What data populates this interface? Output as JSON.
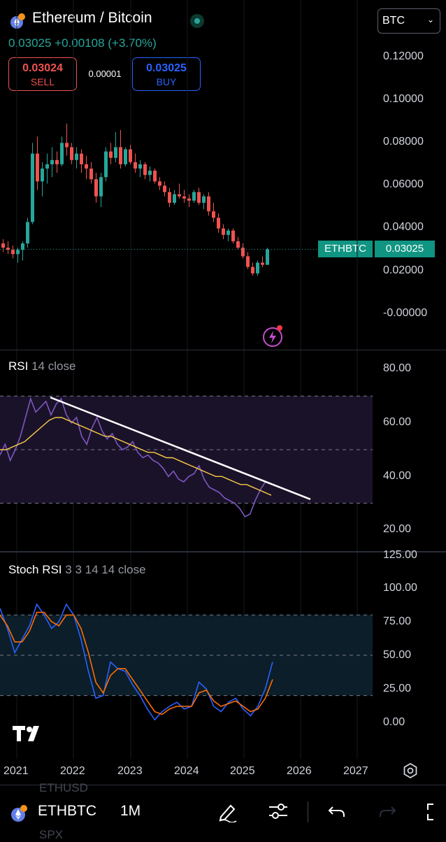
{
  "header": {
    "pair_title": "Ethereum / Bitcoin",
    "price_change": "0.03025 +0.00108 (+3.70%)",
    "sell_value": "0.03024",
    "sell_label": "SELL",
    "spread": "0.00001",
    "buy_value": "0.03025",
    "buy_label": "BUY",
    "currency_select": "BTC"
  },
  "price_axis": [
    "0.12000",
    "0.10000",
    "0.08000",
    "0.06000",
    "0.04000",
    "0.02000",
    "-0.00000"
  ],
  "last_price_tag": {
    "symbol": "ETHBTC",
    "price": "0.03025"
  },
  "rsi": {
    "title": "RSI",
    "params": "14 close",
    "axis": [
      "80.00",
      "60.00",
      "40.00",
      "20.00"
    ],
    "upper_band": 70,
    "lower_band": 30,
    "middle_band": 50
  },
  "stoch_rsi": {
    "title": "Stoch RSI",
    "params": "3 3 14 14 close",
    "axis": [
      "125.00",
      "100.00",
      "75.00",
      "50.00",
      "25.00",
      "0.00"
    ],
    "upper_band": 80,
    "lower_band": 20
  },
  "time_axis": [
    "2021",
    "2022",
    "2023",
    "2024",
    "2025",
    "2026",
    "2027"
  ],
  "bottom_bar": {
    "symbol": "ETHBTC",
    "interval": "1M",
    "ghost_above": "ETHUSD",
    "ghost_below": "SPX"
  },
  "colors": {
    "up": "#26a69a",
    "down": "#ef5350",
    "rsi_line": "#7e57c2",
    "rsi_ma": "#f7c948",
    "stoch_k": "#2962ff",
    "stoch_d": "#ff6d00",
    "band_fill_rsi": "#1a1229",
    "band_fill_stoch": "#0b1e2a"
  },
  "chart_data": [
    {
      "type": "candlestick",
      "title": "Ethereum / Bitcoin",
      "interval": "1M",
      "ylim": [
        -0.005,
        0.13
      ],
      "x": [
        "2021",
        "2022",
        "2023",
        "2024",
        "2025",
        "2026",
        "2027"
      ],
      "last": 0.03025,
      "ohlc": [
        [
          0.033,
          0.035,
          0.029,
          0.031
        ],
        [
          0.031,
          0.034,
          0.028,
          0.03
        ],
        [
          0.03,
          0.032,
          0.026,
          0.028
        ],
        [
          0.028,
          0.031,
          0.024,
          0.03
        ],
        [
          0.03,
          0.034,
          0.025,
          0.033
        ],
        [
          0.033,
          0.045,
          0.031,
          0.043
        ],
        [
          0.043,
          0.08,
          0.042,
          0.075
        ],
        [
          0.075,
          0.083,
          0.058,
          0.062
        ],
        [
          0.062,
          0.071,
          0.055,
          0.068
        ],
        [
          0.068,
          0.075,
          0.061,
          0.07
        ],
        [
          0.07,
          0.078,
          0.064,
          0.072
        ],
        [
          0.072,
          0.076,
          0.066,
          0.07
        ],
        [
          0.07,
          0.083,
          0.069,
          0.08
        ],
        [
          0.08,
          0.089,
          0.074,
          0.078
        ],
        [
          0.078,
          0.08,
          0.07,
          0.072
        ],
        [
          0.072,
          0.078,
          0.068,
          0.075
        ],
        [
          0.075,
          0.077,
          0.066,
          0.07
        ],
        [
          0.07,
          0.074,
          0.063,
          0.068
        ],
        [
          0.068,
          0.071,
          0.061,
          0.063
        ],
        [
          0.063,
          0.066,
          0.052,
          0.055
        ],
        [
          0.055,
          0.066,
          0.05,
          0.064
        ],
        [
          0.064,
          0.078,
          0.062,
          0.076
        ],
        [
          0.076,
          0.08,
          0.07,
          0.073
        ],
        [
          0.073,
          0.085,
          0.071,
          0.078
        ],
        [
          0.078,
          0.086,
          0.068,
          0.07
        ],
        [
          0.07,
          0.078,
          0.069,
          0.077
        ],
        [
          0.077,
          0.079,
          0.07,
          0.071
        ],
        [
          0.071,
          0.075,
          0.066,
          0.068
        ],
        [
          0.068,
          0.072,
          0.064,
          0.07
        ],
        [
          0.07,
          0.071,
          0.063,
          0.065
        ],
        [
          0.065,
          0.069,
          0.062,
          0.067
        ],
        [
          0.067,
          0.068,
          0.061,
          0.062
        ],
        [
          0.062,
          0.064,
          0.058,
          0.06
        ],
        [
          0.06,
          0.062,
          0.055,
          0.057
        ],
        [
          0.057,
          0.059,
          0.05,
          0.052
        ],
        [
          0.052,
          0.058,
          0.051,
          0.056
        ],
        [
          0.056,
          0.061,
          0.054,
          0.055
        ],
        [
          0.055,
          0.058,
          0.052,
          0.054
        ],
        [
          0.054,
          0.056,
          0.05,
          0.053
        ],
        [
          0.053,
          0.058,
          0.052,
          0.057
        ],
        [
          0.057,
          0.059,
          0.051,
          0.052
        ],
        [
          0.052,
          0.056,
          0.049,
          0.055
        ],
        [
          0.055,
          0.057,
          0.046,
          0.048
        ],
        [
          0.048,
          0.052,
          0.043,
          0.045
        ],
        [
          0.045,
          0.047,
          0.038,
          0.04
        ],
        [
          0.04,
          0.042,
          0.035,
          0.037
        ],
        [
          0.037,
          0.04,
          0.034,
          0.039
        ],
        [
          0.039,
          0.04,
          0.033,
          0.034
        ],
        [
          0.034,
          0.036,
          0.03,
          0.031
        ],
        [
          0.031,
          0.033,
          0.026,
          0.027
        ],
        [
          0.027,
          0.029,
          0.021,
          0.022
        ],
        [
          0.022,
          0.024,
          0.018,
          0.019
        ],
        [
          0.019,
          0.025,
          0.018,
          0.024
        ],
        [
          0.024,
          0.027,
          0.022,
          0.023
        ],
        [
          0.023,
          0.031,
          0.023,
          0.03025
        ]
      ]
    },
    {
      "type": "line",
      "title": "RSI",
      "ylim": [
        15,
        85
      ],
      "series": [
        {
          "values": [
            48,
            52,
            46,
            50,
            55,
            62,
            69,
            64,
            66,
            68,
            63,
            67,
            69,
            63,
            60,
            62,
            55,
            52,
            58,
            62,
            57,
            54,
            56,
            52,
            50,
            51,
            53,
            49,
            47,
            48,
            46,
            45,
            43,
            40,
            42,
            39,
            38,
            40,
            41,
            44,
            39,
            36,
            35,
            34,
            32,
            31,
            30,
            28,
            25,
            26,
            31,
            35,
            38
          ]
        },
        {
          "values": [
            50,
            50,
            51,
            52,
            53,
            55,
            57,
            59,
            61,
            62,
            62,
            61,
            60,
            59,
            58,
            57,
            56,
            55,
            55,
            54,
            53,
            52,
            51,
            50,
            49,
            49,
            48,
            47,
            47,
            46,
            45,
            44,
            43,
            42,
            41,
            40,
            40,
            39,
            38,
            37,
            37,
            36,
            35,
            34,
            33
          ]
        }
      ]
    },
    {
      "type": "line",
      "title": "Stoch RSI",
      "ylim": [
        -10,
        125
      ],
      "series": [
        {
          "values": [
            85,
            70,
            52,
            62,
            72,
            88,
            80,
            70,
            75,
            88,
            80,
            62,
            38,
            18,
            20,
            45,
            40,
            38,
            28,
            20,
            10,
            2,
            8,
            12,
            15,
            10,
            12,
            30,
            25,
            12,
            8,
            15,
            18,
            10,
            5,
            12,
            25,
            45
          ]
        },
        {
          "values": [
            80,
            72,
            60,
            60,
            68,
            82,
            82,
            75,
            72,
            80,
            80,
            70,
            52,
            30,
            22,
            35,
            40,
            40,
            32,
            24,
            16,
            8,
            6,
            10,
            12,
            12,
            12,
            22,
            24,
            16,
            12,
            14,
            16,
            12,
            8,
            10,
            18,
            32
          ]
        }
      ]
    }
  ]
}
